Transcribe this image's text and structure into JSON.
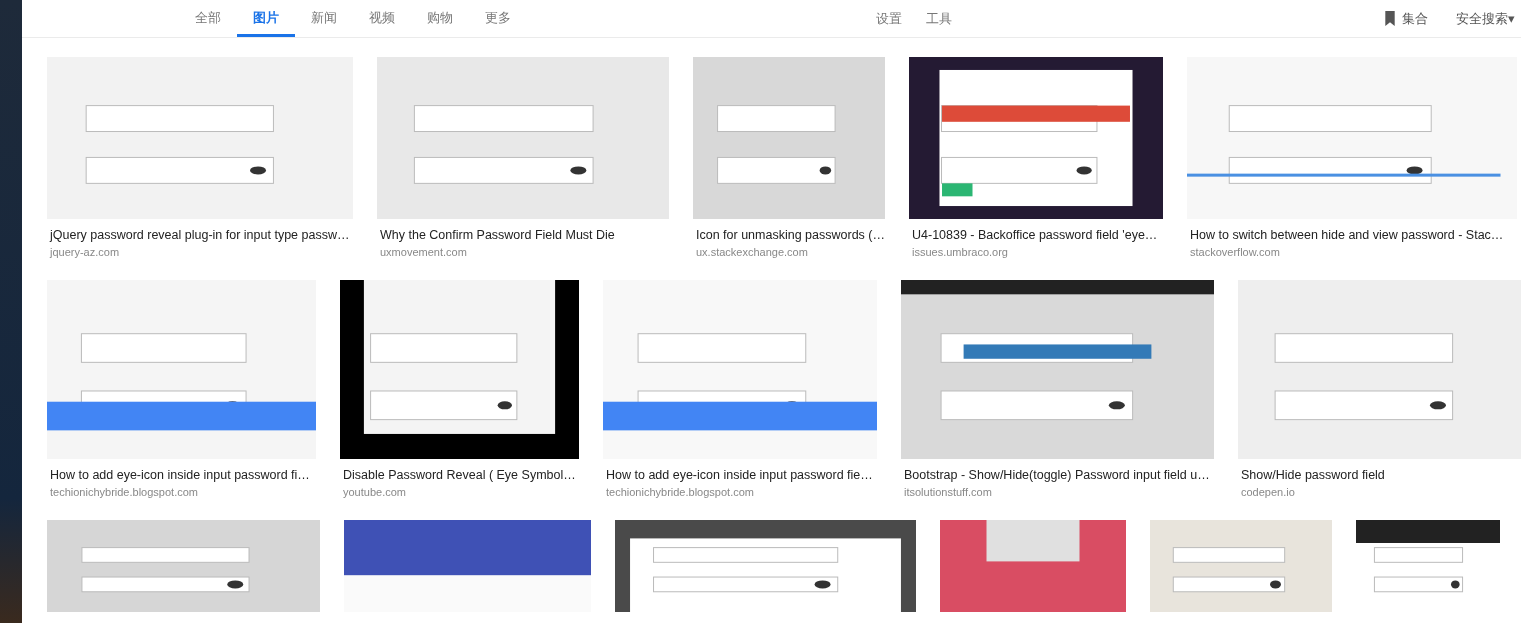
{
  "nav": {
    "tabs": [
      {
        "label": "全部",
        "selected": false
      },
      {
        "label": "图片",
        "selected": true
      },
      {
        "label": "新闻",
        "selected": false
      },
      {
        "label": "视频",
        "selected": false
      },
      {
        "label": "购物",
        "selected": false
      },
      {
        "label": "更多",
        "selected": false
      }
    ],
    "tools": [
      "设置",
      "工具"
    ],
    "collection": "集合",
    "safe_search": "安全搜索▾"
  },
  "rows": [
    {
      "results": [
        {
          "kind": "picture",
          "title": "jQuery password reveal plug-in for input type passw…",
          "source": "jquery-az.com"
        },
        {
          "kind": "picture",
          "title": "Why the Confirm Password Field Must Die",
          "source": "uxmovement.com"
        },
        {
          "kind": "picture",
          "title": "Icon for unmasking passwords (…",
          "source": "ux.stackexchange.com"
        },
        {
          "kind": "picture",
          "title": "U4-10839 - Backoffice password field 'eye…",
          "source": "issues.umbraco.org"
        },
        {
          "kind": "picture",
          "title": "How to switch between hide and view password - Stac…",
          "source": "stackoverflow.com"
        }
      ]
    },
    {
      "results": [
        {
          "kind": "picture",
          "title": "How to add eye-icon inside input password fi…",
          "source": "techionichybride.blogspot.com"
        },
        {
          "kind": "picture",
          "title": "Disable Password Reveal ( Eye Symbol…",
          "source": "youtube.com"
        },
        {
          "kind": "picture",
          "title": "How to add eye-icon inside input password fie…",
          "source": "techionichybride.blogspot.com"
        },
        {
          "kind": "picture",
          "title": "Bootstrap - Show/Hide(toggle) Password input field u…",
          "source": "itsolutionstuff.com"
        },
        {
          "kind": "picture",
          "title": "Show/Hide password field",
          "source": "codepen.io"
        }
      ]
    },
    {
      "results": [
        {
          "kind": "picture"
        },
        {
          "kind": "picture"
        },
        {
          "kind": "picture"
        },
        {
          "kind": "picture"
        },
        {
          "kind": "picture"
        },
        {
          "kind": "picture"
        }
      ]
    }
  ]
}
